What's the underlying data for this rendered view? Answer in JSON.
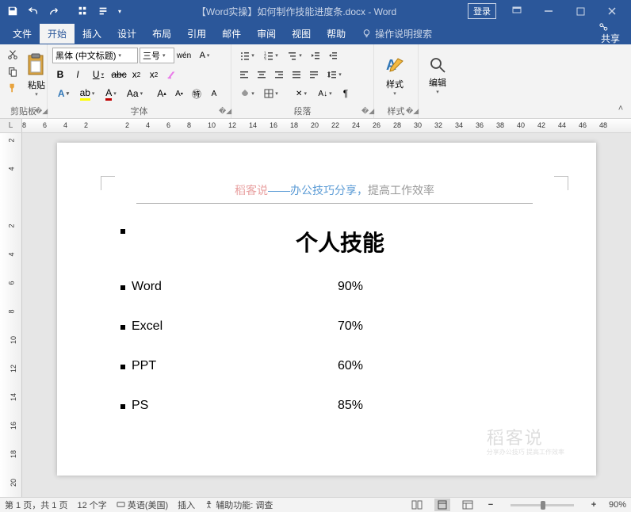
{
  "titlebar": {
    "title": "【Word实操】如何制作技能进度条.docx - Word",
    "login": "登录"
  },
  "menu": {
    "tabs": [
      "文件",
      "开始",
      "插入",
      "设计",
      "布局",
      "引用",
      "邮件",
      "审阅",
      "视图",
      "帮助"
    ],
    "active_index": 1,
    "tell_me": "操作说明搜索",
    "share": "共享"
  },
  "ribbon": {
    "clipboard": {
      "paste": "粘贴",
      "label": "剪贴板"
    },
    "font": {
      "name": "黑体 (中文标题)",
      "size": "三号",
      "label": "字体"
    },
    "paragraph": {
      "label": "段落"
    },
    "styles": {
      "btn": "样式",
      "label": "样式"
    },
    "editing": {
      "btn": "编辑"
    }
  },
  "ruler": {
    "corner": "L",
    "h": [
      "8",
      "6",
      "4",
      "2",
      "",
      "2",
      "4",
      "6",
      "8",
      "10",
      "12",
      "14",
      "16",
      "18",
      "20",
      "22",
      "24",
      "26",
      "28",
      "30",
      "32",
      "34",
      "36",
      "38",
      "40",
      "42",
      "44",
      "46",
      "48"
    ],
    "v": [
      "2",
      "4",
      "",
      "2",
      "4",
      "6",
      "8",
      "10",
      "12",
      "14",
      "16",
      "18",
      "20"
    ]
  },
  "document": {
    "header": {
      "pink": "稻客说",
      "blue": "——办公技巧分享，",
      "gray": "提高工作效率"
    },
    "title": "个人技能",
    "skills": [
      {
        "name": "Word",
        "pct": "90%"
      },
      {
        "name": "Excel",
        "pct": "70%"
      },
      {
        "name": "PPT",
        "pct": "60%"
      },
      {
        "name": "PS",
        "pct": "85%"
      }
    ],
    "watermark": "稻客说",
    "watermark_sub": "分享办公技巧 提高工作效率"
  },
  "status": {
    "page": "第 1 页，共 1 页",
    "words": "12 个字",
    "lang": "英语(美国)",
    "insert": "插入",
    "a11y": "辅助功能: 调查",
    "zoom": "90%"
  }
}
